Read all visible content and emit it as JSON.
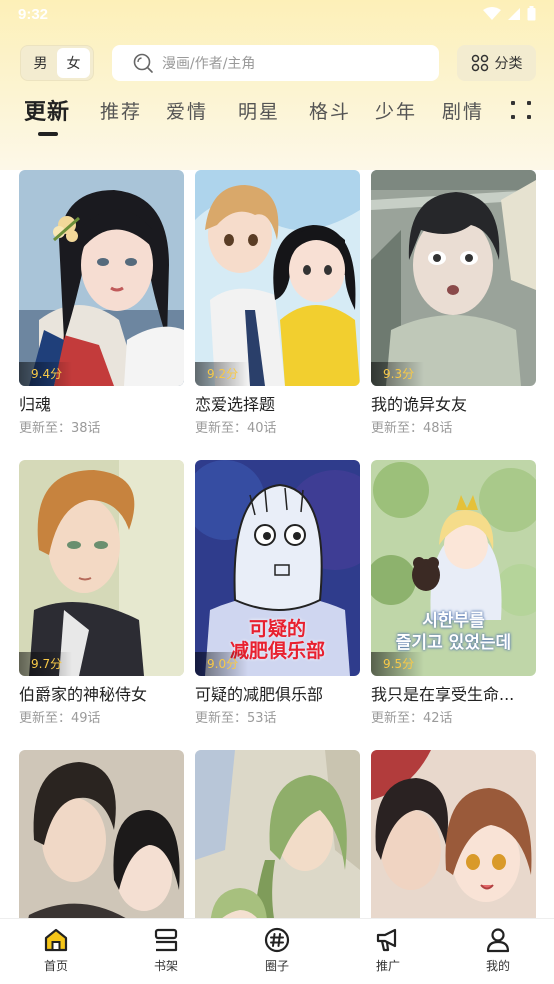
{
  "status_bar": {
    "time": "9:32"
  },
  "header": {
    "gender_options": [
      "男",
      "女"
    ],
    "selected_gender": "女",
    "search_placeholder": "漫画/作者/主角",
    "category_label": "分类"
  },
  "tabs": [
    {
      "label": "更新",
      "active": true
    },
    {
      "label": "推荐",
      "active": false
    },
    {
      "label": "爱情",
      "active": false
    },
    {
      "label": "明星",
      "active": false
    },
    {
      "label": "格斗",
      "active": false
    },
    {
      "label": "少年",
      "active": false
    },
    {
      "label": "剧情",
      "active": false
    }
  ],
  "comics": [
    {
      "title": "归魂",
      "rating": "9.4分",
      "update": "更新至：38话"
    },
    {
      "title": "恋爱选择题",
      "rating": "9.2分",
      "update": "更新至：40话"
    },
    {
      "title": "我的诡异女友",
      "rating": "9.3分",
      "update": "更新至：48话"
    },
    {
      "title": "伯爵家的神秘侍女",
      "rating": "9.7分",
      "update": "更新至：49话"
    },
    {
      "title": "可疑的减肥俱乐部",
      "rating": "9.0分",
      "update": "更新至：53话"
    },
    {
      "title": "我只是在享受生命...",
      "rating": "9.5分",
      "update": "更新至：42话"
    },
    {
      "title": "",
      "rating": "",
      "update": ""
    },
    {
      "title": "",
      "rating": "",
      "update": ""
    },
    {
      "title": "",
      "rating": "",
      "update": ""
    }
  ],
  "cover_art_text": {
    "diet_club_title": "可疑的\n减肥俱乐部",
    "korean_title": "시한부를\n즐기고 있었는데"
  },
  "bottom_nav": [
    {
      "label": "首页",
      "icon": "home-icon",
      "active": true
    },
    {
      "label": "书架",
      "icon": "bookshelf-icon",
      "active": false
    },
    {
      "label": "圈子",
      "icon": "hashtag-icon",
      "active": false
    },
    {
      "label": "推广",
      "icon": "megaphone-icon",
      "active": false
    },
    {
      "label": "我的",
      "icon": "user-icon",
      "active": false
    }
  ],
  "colors": {
    "header_bg": "#fdf0b8",
    "rating_text": "#f7c948",
    "active_nav": "#f5c518"
  }
}
